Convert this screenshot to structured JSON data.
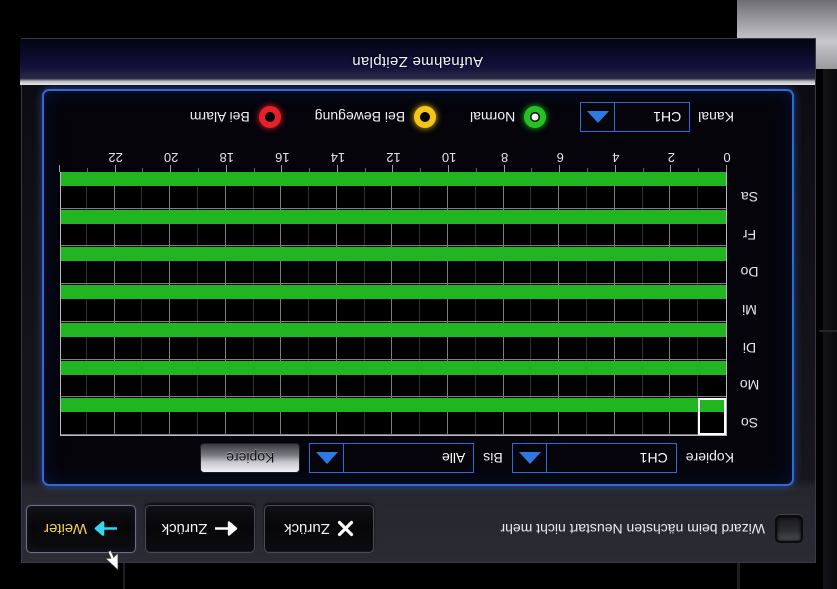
{
  "window": {
    "title": "Aufnahme Zeitplan"
  },
  "toolbar": {
    "wizard_checkbox_label": "Wizard beim nächsten Neustart nicht mehr",
    "wizard_checkbox_checked": false,
    "buttons": [
      {
        "label": "Weiter",
        "icon": "arrow-right-icon",
        "focused": true
      },
      {
        "label": "Zurück",
        "icon": "arrow-left-icon",
        "focused": false
      },
      {
        "label": "Zurück",
        "icon": "close-x-icon",
        "focused": false
      }
    ]
  },
  "copy_row": {
    "copy_label": "Kopiere",
    "source_channel": "CH1",
    "to_label": "Bis",
    "target_channel": "Alle",
    "copy_button": "Kopiere"
  },
  "channel_row": {
    "label": "Kanal",
    "value": "CH1"
  },
  "legend": [
    {
      "label": "Normal",
      "color": "#22c322",
      "selected": true
    },
    {
      "label": "Bei Bewegung",
      "color": "#f5c518",
      "selected": false
    },
    {
      "label": "Bei Alarm",
      "color": "#e8202a",
      "selected": false
    }
  ],
  "colors": {
    "panel_border": "#2f6bd8",
    "record_normal": "#22b522",
    "accent_yellow": "#f2d24a",
    "accent_cyan": "#34d6f0"
  },
  "chart_data": {
    "type": "heatmap",
    "title": "Aufnahme Zeitplan",
    "xlabel": "",
    "ylabel": "",
    "xlim": [
      0,
      24
    ],
    "grid": true,
    "legend_position": "bottom",
    "x_tick_labels": [
      "0",
      "2",
      "4",
      "6",
      "8",
      "10",
      "12",
      "14",
      "16",
      "18",
      "20",
      "22"
    ],
    "x_tick_values": [
      0,
      2,
      4,
      6,
      8,
      10,
      12,
      14,
      16,
      18,
      20,
      22
    ],
    "categories": [
      "So",
      "Mo",
      "Di",
      "Mi",
      "Do",
      "Fr",
      "Sa"
    ],
    "series": [
      {
        "name": "So",
        "mode": "Normal",
        "from_hour": 0,
        "to_hour": 24
      },
      {
        "name": "Mo",
        "mode": "Normal",
        "from_hour": 0,
        "to_hour": 24
      },
      {
        "name": "Di",
        "mode": "Normal",
        "from_hour": 0,
        "to_hour": 24
      },
      {
        "name": "Mi",
        "mode": "Normal",
        "from_hour": 0,
        "to_hour": 24
      },
      {
        "name": "Do",
        "mode": "Normal",
        "from_hour": 0,
        "to_hour": 24
      },
      {
        "name": "Fr",
        "mode": "Normal",
        "from_hour": 0,
        "to_hour": 24
      },
      {
        "name": "Sa",
        "mode": "Normal",
        "from_hour": 0,
        "to_hour": 24
      }
    ],
    "selection": {
      "day": "So",
      "hour": 0
    }
  }
}
